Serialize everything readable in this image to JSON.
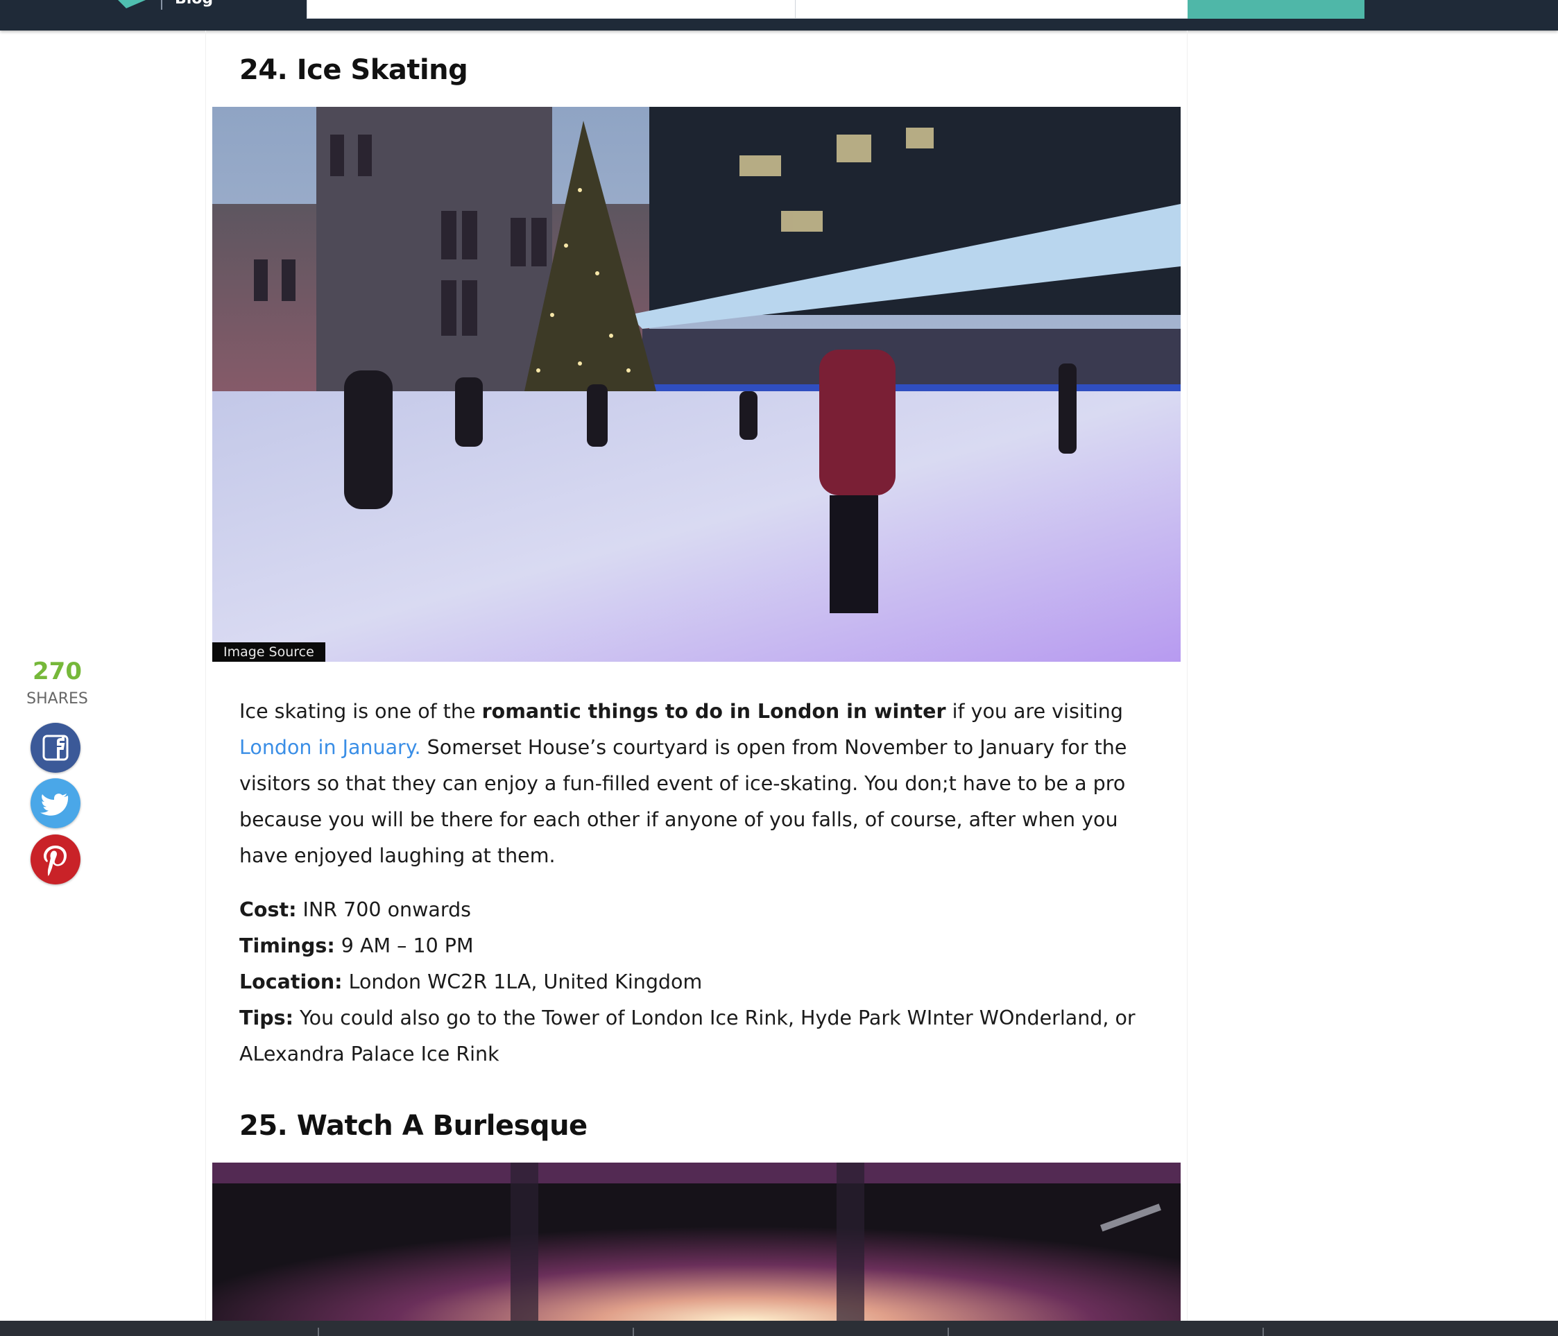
{
  "header": {
    "blog_label": "Blog"
  },
  "sections": [
    {
      "heading": "24. Ice Skating",
      "image_source_label": "Image Source",
      "paragraph": {
        "part1": "Ice skating is one of the ",
        "bold": "romantic things to do in London in winter",
        "part2": " if you are visiting ",
        "link": "London in January.",
        "part3": " Somerset House’s courtyard is open from November to January for the visitors so that they can enjoy a fun-filled event of ice-skating. You don;t have to be a pro because you will be there for each other if anyone of you falls, of course, after when you have enjoyed laughing at them."
      },
      "details": [
        {
          "label": "Cost:",
          "value": " INR 700 onwards"
        },
        {
          "label": "Timings:",
          "value": " 9 AM – 10 PM"
        },
        {
          "label": "Location:",
          "value": " London WC2R 1LA, United Kingdom"
        },
        {
          "label": "Tips:",
          "value": " You could also go to the Tower of London Ice Rink, Hyde Park WInter WOnderland, or ALexandra Palace Ice Rink"
        }
      ]
    },
    {
      "heading": "25. Watch A Burlesque"
    }
  ],
  "share": {
    "count": "270",
    "label": "SHARES",
    "icons": [
      "facebook-icon",
      "twitter-icon",
      "pinterest-icon"
    ]
  },
  "colors": {
    "topbar": "#1f2a38",
    "accent": "#4fb7a8",
    "link": "#3a8ee6",
    "share_count": "#76b83a",
    "facebook": "#3b5998",
    "twitter": "#4aa7e8",
    "pinterest": "#c92228"
  }
}
